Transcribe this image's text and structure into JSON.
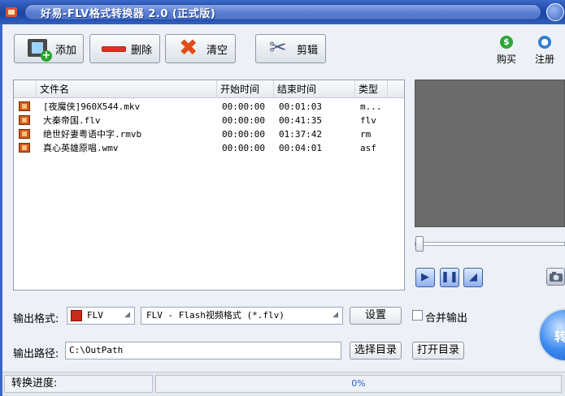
{
  "window": {
    "title": "好易-FLV格式转换器 2.0 (正式版)"
  },
  "toolbar": {
    "add_label": "添加",
    "delete_label": "删除",
    "clear_label": "清空",
    "cut_label": "剪辑",
    "buy_label": "购买",
    "register_label": "注册"
  },
  "filelist": {
    "columns": [
      "文件名",
      "开始时间",
      "结束时间",
      "类型"
    ],
    "rows": [
      {
        "name": "[夜魔侠]960X544.mkv",
        "start": "00:00:00",
        "end": "00:01:03",
        "type": "m..."
      },
      {
        "name": "大秦帝国.flv",
        "start": "00:00:00",
        "end": "00:41:35",
        "type": "flv"
      },
      {
        "name": "绝世好妻粤语中字.rmvb",
        "start": "00:00:00",
        "end": "01:37:42",
        "type": "rm"
      },
      {
        "name": "真心英雄原唱.wmv",
        "start": "00:00:00",
        "end": "00:04:01",
        "type": "asf"
      }
    ]
  },
  "output": {
    "format_label": "输出格式:",
    "format_value": "FLV",
    "format_desc": "FLV - Flash视频格式 (*.flv)",
    "settings_label": "设置",
    "merge_label": "合并输出",
    "path_label": "输出路径:",
    "path_value": "C:\\OutPath",
    "choose_dir_label": "选择目录",
    "open_dir_label": "打开目录",
    "convert_label": "转"
  },
  "status": {
    "progress_label": "转换进度:",
    "progress_value": "0%"
  },
  "colors": {
    "titlebar": "#1d4aa8",
    "preview": "#6c6c6c",
    "accent": "#2a62c7"
  },
  "icons": {
    "add": "film-plus-icon",
    "delete": "minus-bar-icon",
    "clear": "red-x-icon",
    "cut": "scissors-icon",
    "buy": "dollar-icon",
    "register": "register-icon",
    "play": "play-icon",
    "pause": "pause-icon",
    "stop": "stop-icon",
    "snapshot": "camera-icon"
  }
}
